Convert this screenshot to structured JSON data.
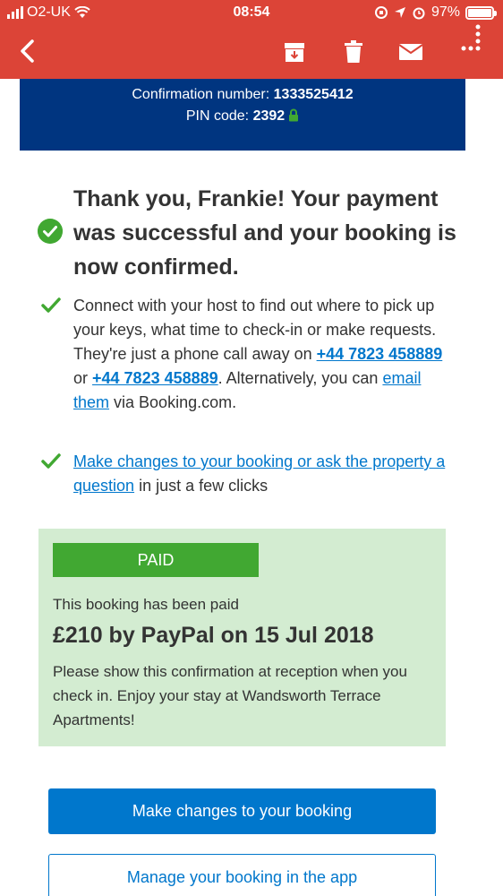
{
  "status_bar": {
    "carrier": "O2-UK",
    "time": "08:54",
    "battery": "97%"
  },
  "confirmation": {
    "number_label": "Confirmation number:",
    "number": "1333525412",
    "pin_label": "PIN code:",
    "pin": "2392"
  },
  "heading": "Thank you, Frankie! Your payment was successful and your booking is now confirmed.",
  "host_contact": {
    "text_1": "Connect with your host to find out where to pick up your keys, what time to check-in or make requests. They're just a phone call away on ",
    "phone_1": "+44 7823 458889",
    "or": " or ",
    "phone_2": "+44 7823 458889",
    "text_2": ". Alternatively, you can ",
    "email_link": "email them",
    "text_3": " via Booking.com."
  },
  "make_changes": {
    "link": "Make changes to your booking or ask the property a question",
    "suffix": " in just a few clicks"
  },
  "payment": {
    "badge": "PAID",
    "status_text": "This booking has been paid",
    "amount": "£210 by PayPal on 15 Jul 2018",
    "note": "Please show this confirmation at reception when you check in. Enjoy your stay at Wandsworth Terrace Apartments!"
  },
  "buttons": {
    "make_changes": "Make changes to your booking",
    "manage_app": "Manage your booking in the app"
  },
  "colors": {
    "app_bar": "#dc4437",
    "brand_blue": "#003580",
    "link_blue": "#0077cc",
    "success_green": "#41a832",
    "paid_panel": "#d3ecd1"
  }
}
